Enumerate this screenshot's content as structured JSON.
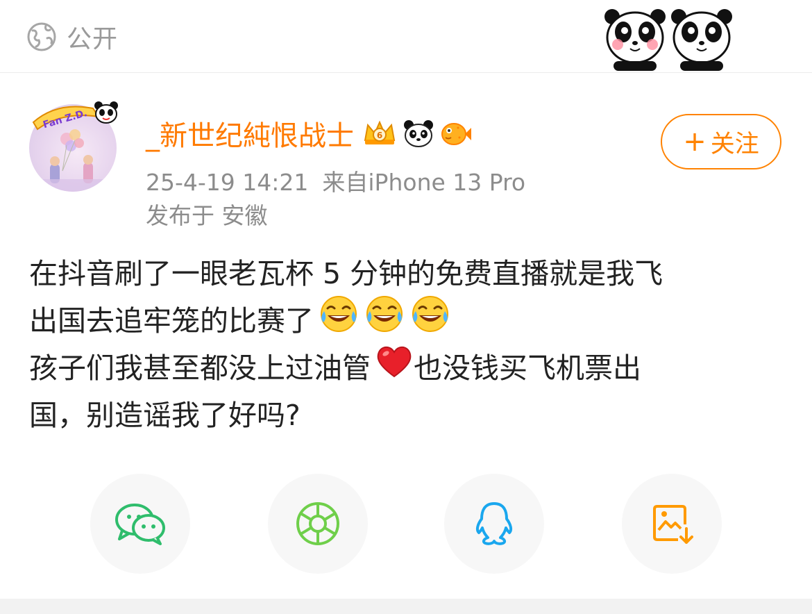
{
  "header": {
    "visibility_label": "公开",
    "visibility_icon": "globe-icon"
  },
  "post": {
    "author": {
      "username": "_新世纪純恨战士",
      "avatar_badge_text": "Fan Z.D."
    },
    "meta": {
      "timestamp": "25-4-19 14:21",
      "source": "来自iPhone 13 Pro",
      "location": "发布于 安徽"
    },
    "follow_button": {
      "plus": "+",
      "label": "关注"
    },
    "content": {
      "line1": "在抖音刷了一眼老瓦杯 5 分钟的免费直播就是我飞",
      "line2": "出国去追牢笼的比赛了",
      "line3a": "孩子们我甚至都没上过油管",
      "line3b": "也没钱买飞机票出",
      "line4": "国，别造谣我了好吗?"
    }
  },
  "share_bar": [
    {
      "name": "wechat-share",
      "icon": "wechat-icon"
    },
    {
      "name": "moments-share",
      "icon": "moments-icon"
    },
    {
      "name": "qq-share",
      "icon": "qq-icon"
    },
    {
      "name": "save-image",
      "icon": "save-image-icon"
    }
  ],
  "colors": {
    "accent": "#ff8200",
    "username": "#ff7a00",
    "meta": "#8c8c8c",
    "wechat": "#2fbd6c",
    "moments": "#6fcf4a",
    "qq": "#1aa7ee",
    "save": "#ff9a00"
  }
}
